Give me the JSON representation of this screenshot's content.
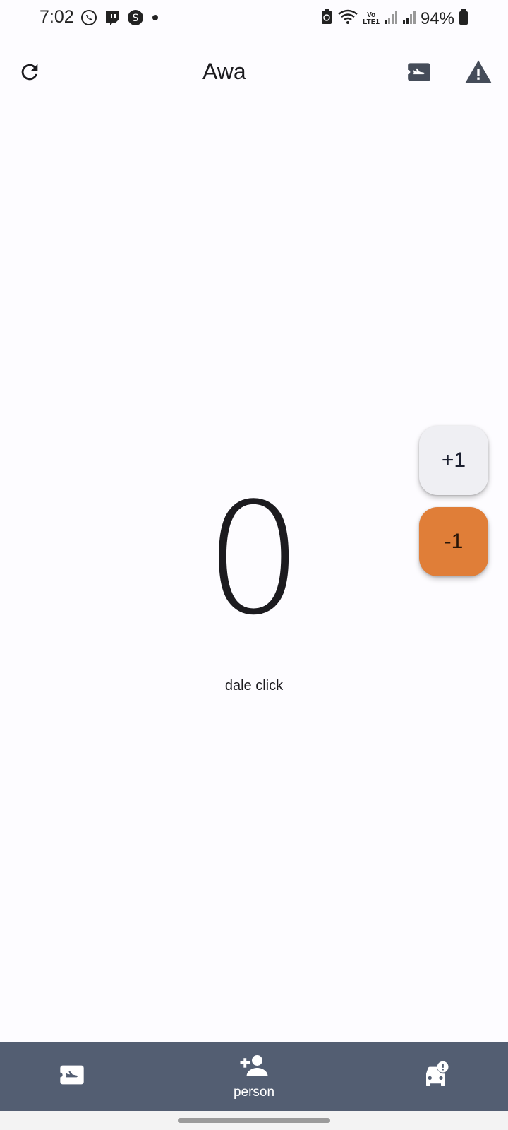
{
  "status_bar": {
    "time": "7:02",
    "battery": "94%",
    "network_top": "Vo",
    "network_bottom": "LTE1"
  },
  "app_bar": {
    "title": "Awa",
    "left_icon": "refresh-icon",
    "right_icons": [
      "airplane-ticket-icon",
      "warning-icon"
    ]
  },
  "counter": {
    "value": "0",
    "label": "dale click"
  },
  "fabs": {
    "increment_label": "+1",
    "decrement_label": "-1",
    "increment_color": "#efeff3",
    "decrement_color": "#e07e38"
  },
  "bottom_nav": {
    "background": "#535e72",
    "items": [
      {
        "icon": "airplane-ticket-icon",
        "label": ""
      },
      {
        "icon": "person-add-icon",
        "label": "person"
      },
      {
        "icon": "car-crash-icon",
        "label": ""
      }
    ]
  }
}
